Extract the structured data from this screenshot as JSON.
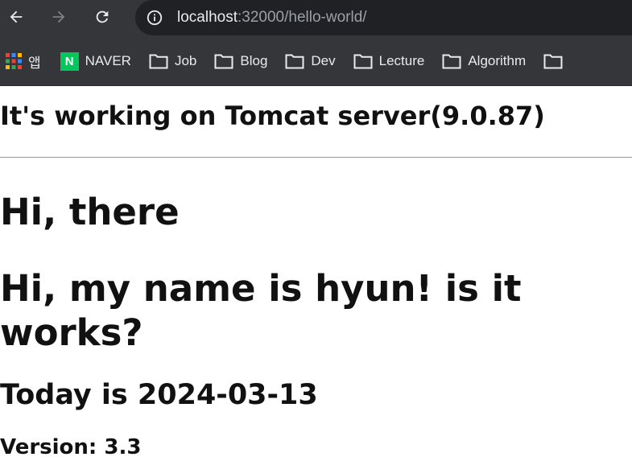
{
  "browser": {
    "url_host": "localhost",
    "url_rest": ":32000/hello-world/"
  },
  "bookmarks": {
    "apps_label": "앱",
    "naver_logo": "N",
    "naver_label": "NAVER",
    "folders": [
      "Job",
      "Blog",
      "Dev",
      "Lecture",
      "Algorithm"
    ]
  },
  "page": {
    "server_heading": "It's working on Tomcat server(9.0.87)",
    "greeting": "Hi, there",
    "intro": "Hi, my name is hyun! is it works?",
    "today": "Today is 2024-03-13",
    "version": "Version: 3.3"
  },
  "colors": {
    "toolbar": "#35363a",
    "omnibox": "#202124",
    "naver_green": "#03c75a"
  }
}
